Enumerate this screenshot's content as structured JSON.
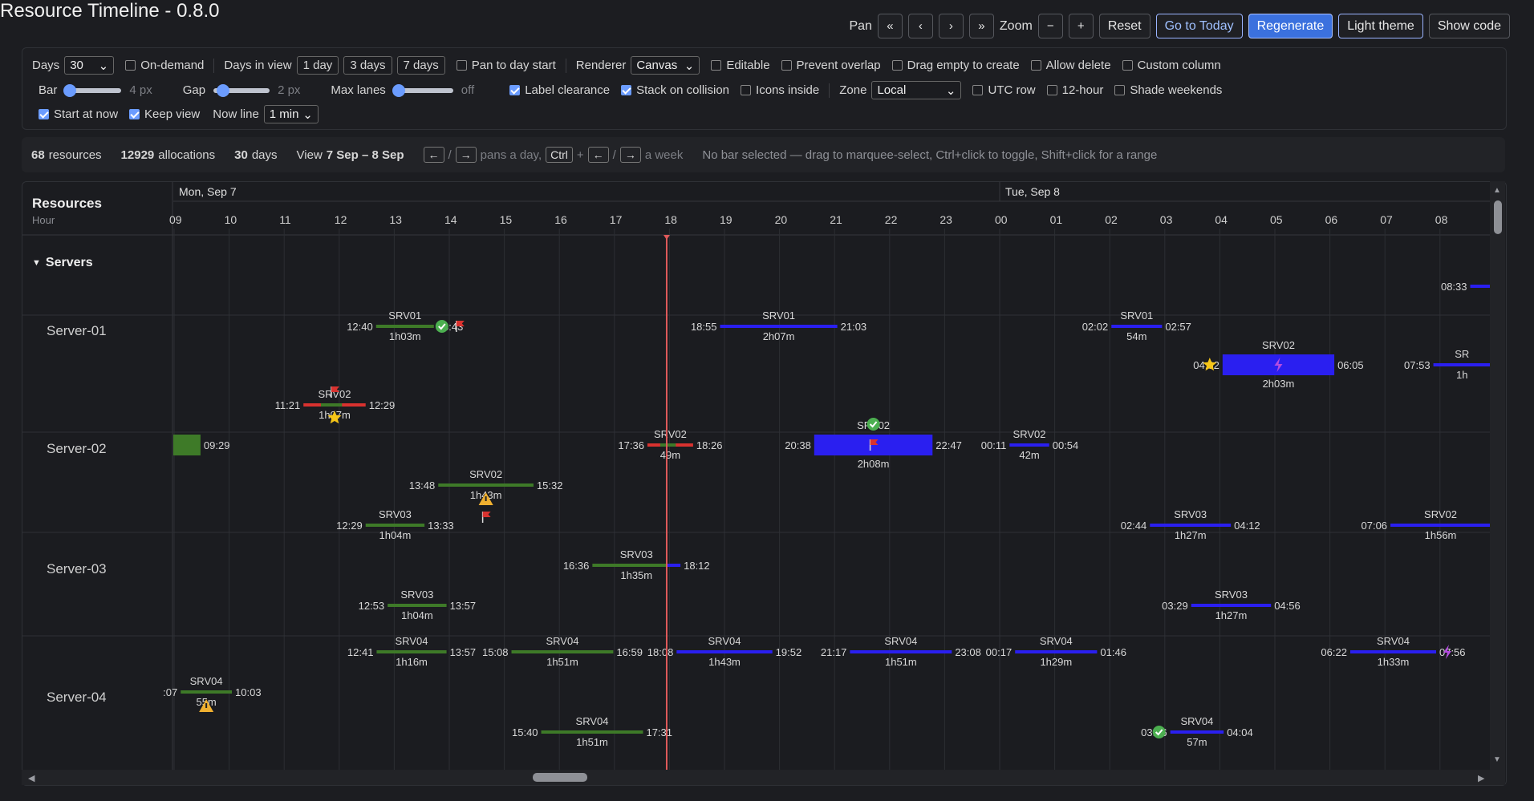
{
  "app": {
    "title": "Resource Timeline - 0.8.0"
  },
  "toolbar": {
    "pan_label": "Pan",
    "zoom_label": "Zoom",
    "pan_first": "«",
    "pan_prev": "‹",
    "pan_next": "›",
    "pan_last": "»",
    "zoom_out": "−",
    "zoom_in": "+",
    "reset": "Reset",
    "today": "Go to Today",
    "regenerate": "Regenerate",
    "theme": "Light theme",
    "show_code": "Show code"
  },
  "controls": {
    "days_label": "Days",
    "days_value": "30",
    "on_demand": "On-demand",
    "days_in_view_label": "Days in view",
    "view_1": "1 day",
    "view_3": "3 days",
    "view_7": "7 days",
    "pan_to_day_start": "Pan to day start",
    "renderer_label": "Renderer",
    "renderer_value": "Canvas",
    "editable": "Editable",
    "prevent_overlap": "Prevent overlap",
    "drag_empty": "Drag empty to create",
    "allow_delete": "Allow delete",
    "custom_column": "Custom column",
    "bar_label": "Bar",
    "bar_value": "4 px",
    "gap_label": "Gap",
    "gap_value": "2 px",
    "max_lanes_label": "Max lanes",
    "max_lanes_value": "off",
    "label_clearance": "Label clearance",
    "stack_on_collision": "Stack on collision",
    "icons_inside": "Icons inside",
    "zone_label": "Zone",
    "zone_value": "Local",
    "utc_row": "UTC row",
    "twelve_hour": "12-hour",
    "shade_weekends": "Shade weekends",
    "start_at_now": "Start at now",
    "keep_view": "Keep view",
    "now_line_label": "Now line",
    "now_line_value": "1 min"
  },
  "stats": {
    "resources_count": "68",
    "resources_label": "resources",
    "allocations_count": "12929",
    "allocations_label": "allocations",
    "days_count": "30",
    "days_label": "days",
    "view_label": "View",
    "view_range": "7 Sep – 8 Sep",
    "hint_left": "←",
    "hint_slash": "/",
    "hint_right": "→",
    "hint_day": "pans a day,",
    "hint_ctrl": "Ctrl",
    "hint_plus": "+",
    "hint_week": "a week",
    "selection_hint": "No bar selected — drag to marquee-select, Ctrl+click to toggle, Shift+click for a range"
  },
  "timeline": {
    "resources_title": "Resources",
    "resources_sub": "Hour",
    "group": "Servers",
    "day1": "Mon, Sep 7",
    "day2": "Tue, Sep 8",
    "hours": [
      "09",
      "10",
      "11",
      "12",
      "13",
      "14",
      "15",
      "16",
      "17",
      "18",
      "19",
      "20",
      "21",
      "22",
      "23",
      "00",
      "01",
      "02",
      "03",
      "04",
      "05",
      "06",
      "07",
      "08"
    ],
    "lanes": [
      "Server-01",
      "Server-02",
      "Server-03",
      "Server-04"
    ],
    "now_hour": 17.95,
    "colors": {
      "past": "#3e7a28",
      "future": "#2a1ff0",
      "conflict": "#d9322f",
      "now": "#e05a5a",
      "icon_ok": "#4caf50",
      "icon_warn": "#f0b030",
      "icon_star": "#f5c518",
      "icon_bolt": "#b44ce0"
    },
    "allocations": [
      {
        "lane": 0,
        "row": 0,
        "start": 12.67,
        "end": 13.72,
        "code": "SRV01",
        "s": "12:40",
        "e": "13:43",
        "dur": "1h03m",
        "icons": [
          "check-icon",
          "flag-icon"
        ]
      },
      {
        "lane": 0,
        "row": 0,
        "start": 18.92,
        "end": 21.05,
        "code": "SRV01",
        "s": "18:55",
        "e": "21:03",
        "dur": "2h07m"
      },
      {
        "lane": 0,
        "row": 0,
        "start": 26.03,
        "end": 26.95,
        "code": "SRV01",
        "s": "02:02",
        "e": "02:57",
        "dur": "54m"
      },
      {
        "lane": 0,
        "row": -1,
        "start": 32.55,
        "end": 33.3,
        "code": "",
        "s": "08:33",
        "e": "",
        "dur": ""
      },
      {
        "lane": 1,
        "row": -1,
        "start": 11.35,
        "end": 12.48,
        "code": "SRV02",
        "s": "11:21",
        "e": "12:29",
        "dur": "1h07m",
        "conflict": true,
        "icons": [
          "flag-icon",
          "star-icon"
        ]
      },
      {
        "lane": 1,
        "row": 0,
        "start": 8.3,
        "end": 9.48,
        "code": "",
        "s": "",
        "e": "09:29",
        "dur": "",
        "thick": true
      },
      {
        "lane": 1,
        "row": 0,
        "start": 17.6,
        "end": 18.43,
        "code": "SRV02",
        "s": "17:36",
        "e": "18:26",
        "dur": "49m",
        "conflict": true
      },
      {
        "lane": 1,
        "row": 0,
        "start": 20.63,
        "end": 22.78,
        "code": "SRV02",
        "s": "20:38",
        "e": "22:47",
        "dur": "2h08m",
        "thick": true,
        "icons": [
          "check-icon",
          "flag-icon"
        ]
      },
      {
        "lane": 1,
        "row": 0,
        "start": 24.18,
        "end": 24.9,
        "code": "SRV02",
        "s": "00:11",
        "e": "00:54",
        "dur": "42m"
      },
      {
        "lane": 1,
        "row": -2,
        "start": 28.05,
        "end": 30.08,
        "code": "SRV02",
        "s": "04:02",
        "e": "06:05",
        "dur": "2h03m",
        "thick": true,
        "icons": [
          "star-icon",
          "bolt-icon"
        ]
      },
      {
        "lane": 1,
        "row": -2,
        "start": 31.88,
        "end": 33.5,
        "code": "SR",
        "s": "07:53",
        "e": "",
        "dur": "1h"
      },
      {
        "lane": 1,
        "row": 1,
        "start": 13.8,
        "end": 15.53,
        "code": "SRV02",
        "s": "13:48",
        "e": "15:32",
        "dur": "1h43m",
        "icons": [
          "warn-icon",
          "flag-icon"
        ]
      },
      {
        "lane": 1,
        "row": 2,
        "start": 31.1,
        "end": 33.3,
        "code": "SRV02",
        "s": "07:06",
        "e": "",
        "dur": "1h56m"
      },
      {
        "lane": 2,
        "row": -1,
        "start": 12.48,
        "end": 13.55,
        "code": "SRV03",
        "s": "12:29",
        "e": "13:33",
        "dur": "1h04m"
      },
      {
        "lane": 2,
        "row": -1,
        "start": 26.73,
        "end": 28.2,
        "code": "SRV03",
        "s": "02:44",
        "e": "04:12",
        "dur": "1h27m"
      },
      {
        "lane": 2,
        "row": 0,
        "start": 16.6,
        "end": 18.2,
        "code": "SRV03",
        "s": "16:36",
        "e": "18:12",
        "dur": "1h35m"
      },
      {
        "lane": 2,
        "row": 1,
        "start": 12.88,
        "end": 13.95,
        "code": "SRV03",
        "s": "12:53",
        "e": "13:57",
        "dur": "1h04m"
      },
      {
        "lane": 2,
        "row": 1,
        "start": 27.48,
        "end": 28.93,
        "code": "SRV03",
        "s": "03:29",
        "e": "04:56",
        "dur": "1h27m"
      },
      {
        "lane": 3,
        "row": -1,
        "start": 12.68,
        "end": 13.95,
        "code": "SRV04",
        "s": "12:41",
        "e": "13:57",
        "dur": "1h16m"
      },
      {
        "lane": 3,
        "row": -1,
        "start": 15.13,
        "end": 16.98,
        "code": "SRV04",
        "s": "15:08",
        "e": "16:59",
        "dur": "1h51m"
      },
      {
        "lane": 3,
        "row": -1,
        "start": 18.13,
        "end": 19.87,
        "code": "SRV04",
        "s": "18:08",
        "e": "19:52",
        "dur": "1h43m"
      },
      {
        "lane": 3,
        "row": -1,
        "start": 21.28,
        "end": 23.13,
        "code": "SRV04",
        "s": "21:17",
        "e": "23:08",
        "dur": "1h51m"
      },
      {
        "lane": 3,
        "row": -1,
        "start": 24.28,
        "end": 25.77,
        "code": "SRV04",
        "s": "00:17",
        "e": "01:46",
        "dur": "1h29m"
      },
      {
        "lane": 3,
        "row": -1,
        "start": 30.37,
        "end": 31.93,
        "code": "SRV04",
        "s": "06:22",
        "e": "07:56",
        "dur": "1h33m",
        "icons": [
          "bolt-icon"
        ]
      },
      {
        "lane": 3,
        "row": 0,
        "start": 9.12,
        "end": 10.05,
        "code": "SRV04",
        "s": ":07",
        "e": "10:03",
        "dur": "55m",
        "icons": [
          "warn-icon"
        ]
      },
      {
        "lane": 3,
        "row": 1,
        "start": 15.67,
        "end": 17.52,
        "code": "SRV04",
        "s": "15:40",
        "e": "17:31",
        "dur": "1h51m"
      },
      {
        "lane": 3,
        "row": 1,
        "start": 27.1,
        "end": 28.07,
        "code": "SRV04",
        "s": "03:06",
        "e": "04:04",
        "dur": "57m",
        "icons": [
          "check-icon"
        ]
      }
    ]
  }
}
